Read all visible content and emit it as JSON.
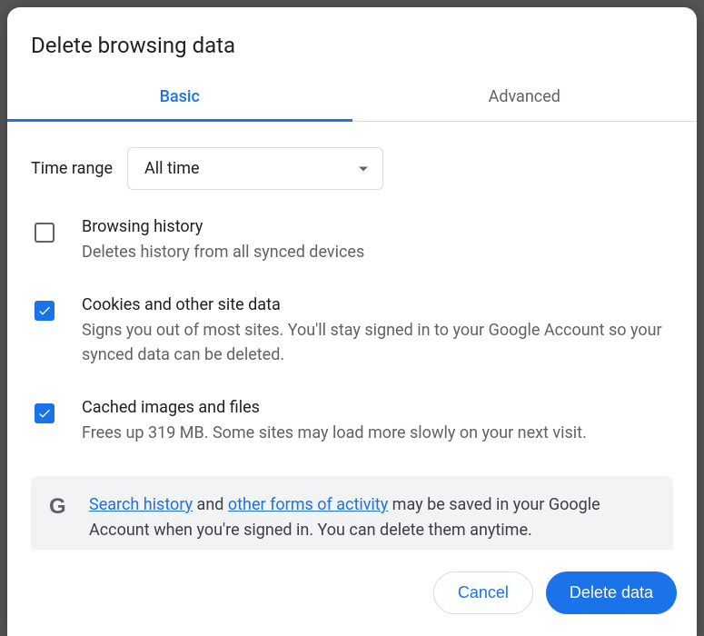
{
  "dialog": {
    "title": "Delete browsing data",
    "tabs": {
      "basic": "Basic",
      "advanced": "Advanced"
    },
    "timeRange": {
      "label": "Time range",
      "value": "All time"
    },
    "options": [
      {
        "title": "Browsing history",
        "desc": "Deletes history from all synced devices",
        "checked": false
      },
      {
        "title": "Cookies and other site data",
        "desc": "Signs you out of most sites. You'll stay signed in to your Google Account so your synced data can be deleted.",
        "checked": true
      },
      {
        "title": "Cached images and files",
        "desc": "Frees up 319 MB. Some sites may load more slowly on your next visit.",
        "checked": true
      }
    ],
    "info": {
      "link1": "Search history",
      "mid1": " and ",
      "link2": "other forms of activity",
      "rest": " may be saved in your Google Account when you're signed in. You can delete them anytime."
    },
    "buttons": {
      "cancel": "Cancel",
      "delete": "Delete data"
    }
  }
}
